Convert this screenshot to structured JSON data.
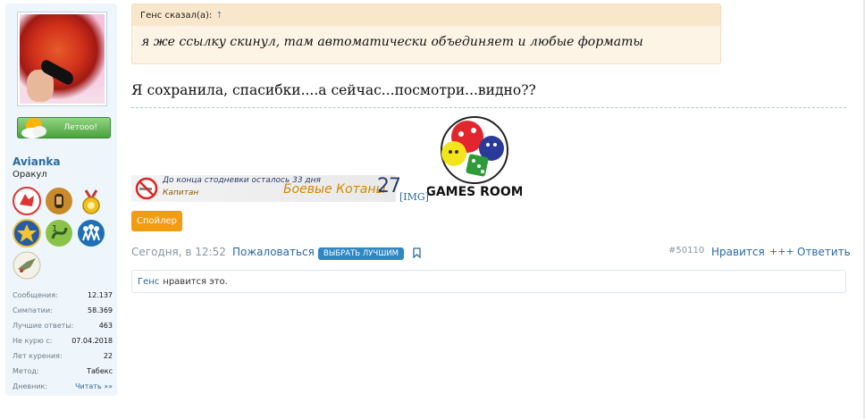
{
  "user": {
    "name": "Avianka",
    "title": "Оракул",
    "status_label": "Летооо!",
    "stats": [
      {
        "key": "Сообщения:",
        "value": "12.137"
      },
      {
        "key": "Симпатии:",
        "value": "58.369"
      },
      {
        "key": "Лучшие ответы:",
        "value": "463"
      },
      {
        "key": "Не курю с:",
        "value": "07.04.2018"
      },
      {
        "key": "Лет курения:",
        "value": "22"
      },
      {
        "key": "Метод:",
        "value": "Табекс"
      },
      {
        "key": "Дневник:",
        "value": "Читать »»"
      }
    ],
    "awards": [
      "wolf-award-icon",
      "pharaoh-award-icon",
      "cup-award-icon",
      "star-award-icon",
      "snake-award-icon",
      "people-award-icon",
      "bird-award-icon"
    ]
  },
  "quote": {
    "author": "Генс сказал(а):",
    "arrow": "↑",
    "text": "я же ссылку скинул, там автоматически объединяет и любые форматы"
  },
  "message": {
    "text": "Я сохранила, спасибки....а сейчас...посмотри...видно??",
    "logo_text": "GAMES ROOM"
  },
  "signature": {
    "line1": "До конца стодневки осталось 33 дня",
    "line2": "Капитан",
    "group": "Боевые Котаны",
    "number": "27",
    "img_link": "[IMG]"
  },
  "spoiler_label": "Спойлер",
  "meta": {
    "date": "Сегодня, в 12:52",
    "report": "Пожаловаться",
    "best": "ВЫБРАТЬ ЛУЧШИМ",
    "post_number": "#50110",
    "like": "Нравится",
    "plus": "+++",
    "reply": "Ответить"
  },
  "likes": {
    "name": "Генс",
    "suffix": "нравится это."
  },
  "colors": {
    "link": "#2b6aa3",
    "quote_bg": "#fdf4e6",
    "spoiler": "#f39c12",
    "best_badge": "#2d88c4"
  }
}
